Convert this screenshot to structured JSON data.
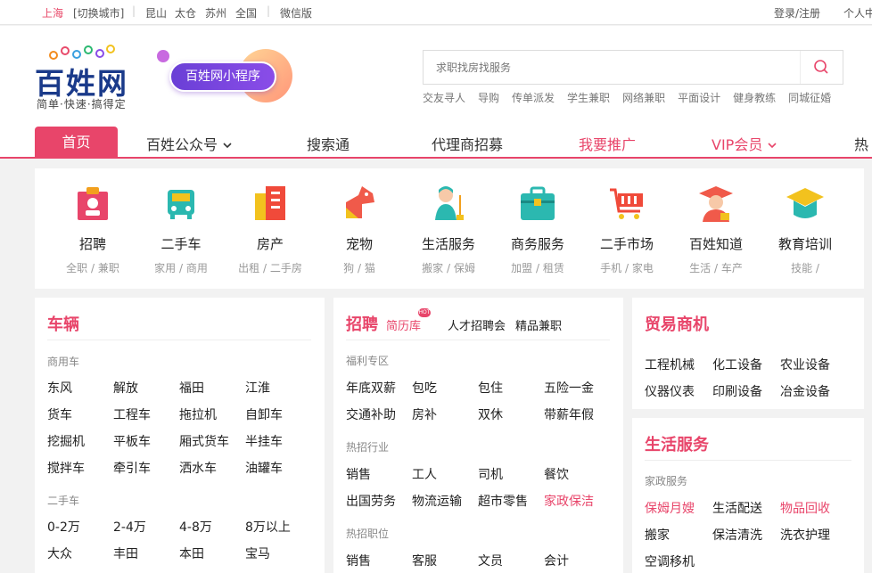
{
  "topbar": {
    "city": "上海",
    "switch_city": "[切换城市]",
    "quick_cities": [
      "昆山",
      "太仓",
      "苏州",
      "全国"
    ],
    "wechat": "微信版",
    "login": "登录/注册",
    "personal": "个人中"
  },
  "header": {
    "logo_text": "百姓网",
    "logo_sub": "简单·快速·搞得定",
    "mini_program": "百姓网小程序",
    "search_placeholder": "求职找房找服务",
    "hotwords": [
      "交友寻人",
      "导购",
      "传单派发",
      "学生兼职",
      "网络兼职",
      "平面设计",
      "健身教练",
      "同城征婚"
    ]
  },
  "nav": {
    "home": "首页",
    "items": [
      "百姓公众号",
      "搜索通",
      "代理商招募",
      "我要推广",
      "VIP会员",
      "热"
    ]
  },
  "categories": [
    {
      "name": "招聘",
      "sub": "全职 / 兼职",
      "icon": "recruit-icon",
      "color": "#e8456a"
    },
    {
      "name": "二手车",
      "sub": "家用 / 商用",
      "icon": "car-icon",
      "color": "#2bb8b0"
    },
    {
      "name": "房产",
      "sub": "出租 / 二手房",
      "icon": "building-icon",
      "color": "#f04a3a"
    },
    {
      "name": "宠物",
      "sub": "狗 / 猫",
      "icon": "dog-icon",
      "color": "#f05a4a"
    },
    {
      "name": "生活服务",
      "sub": "搬家 / 保姆",
      "icon": "cleaner-icon",
      "color": "#2bb8b0"
    },
    {
      "name": "商务服务",
      "sub": "加盟 / 租赁",
      "icon": "briefcase-icon",
      "color": "#2bb8b0"
    },
    {
      "name": "二手市场",
      "sub": "手机 / 家电",
      "icon": "cart-icon",
      "color": "#f04a3a"
    },
    {
      "name": "百姓知道",
      "sub": "生活 / 车产",
      "icon": "graduate-icon",
      "color": "#f05a4a"
    },
    {
      "name": "教育培训",
      "sub": "技能 /",
      "icon": "mortarboard-icon",
      "color": "#2bb8b0"
    }
  ],
  "vehicles": {
    "title": "车辆",
    "groups": [
      {
        "label": "商用车",
        "rows": [
          [
            "东风",
            "解放",
            "福田",
            "江淮"
          ],
          [
            "货车",
            "工程车",
            "拖拉机",
            "自卸车"
          ],
          [
            "挖掘机",
            "平板车",
            "厢式货车",
            "半挂车"
          ],
          [
            "搅拌车",
            "牵引车",
            "洒水车",
            "油罐车"
          ]
        ]
      },
      {
        "label": "二手车",
        "rows": [
          [
            "0-2万",
            "2-4万",
            "4-8万",
            "8万以上"
          ],
          [
            "大众",
            "丰田",
            "本田",
            "宝马"
          ]
        ]
      }
    ]
  },
  "recruit": {
    "title": "招聘",
    "tabs": [
      "简历库",
      "人才招聘会",
      "精品兼职"
    ],
    "hot_badge": "HOT",
    "groups": [
      {
        "label": "福利专区",
        "rows": [
          [
            "年底双薪",
            "包吃",
            "包住",
            "五险一金"
          ],
          [
            "交通补助",
            "房补",
            "双休",
            "带薪年假"
          ]
        ]
      },
      {
        "label": "热招行业",
        "rows": [
          [
            "销售",
            "工人",
            "司机",
            "餐饮"
          ],
          [
            "出国劳务",
            "物流运输",
            "超市零售",
            "家政保洁"
          ]
        ]
      },
      {
        "label": "热招职位",
        "rows": [
          [
            "销售",
            "客服",
            "文员",
            "会计"
          ]
        ]
      }
    ]
  },
  "trade": {
    "title": "贸易商机",
    "rows": [
      [
        "工程机械",
        "化工设备",
        "农业设备"
      ],
      [
        "仪器仪表",
        "印刷设备",
        "冶金设备"
      ]
    ]
  },
  "life": {
    "title": "生活服务",
    "group_label": "家政服务",
    "rows": [
      [
        "保姆月嫂",
        "生活配送",
        "物品回收"
      ],
      [
        "搬家",
        "保洁清洗",
        "洗衣护理"
      ],
      [
        "空调移机"
      ]
    ]
  },
  "colors": {
    "brand": "#e8456a",
    "logo": "#1a3a8a",
    "mini_program": "#7a45e0"
  }
}
